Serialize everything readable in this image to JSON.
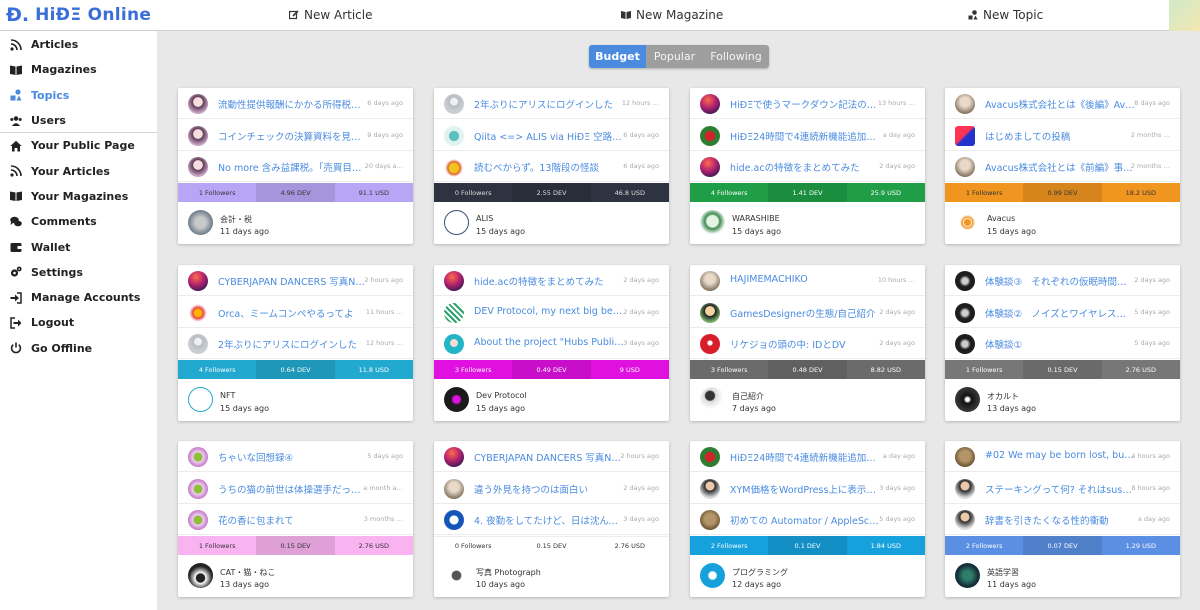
{
  "header": {
    "logo_text": "HiÐΞ Online",
    "logo_mark": "Đ.",
    "nav": [
      {
        "label": "New Article",
        "icon": "edit-icon"
      },
      {
        "label": "New Magazine",
        "icon": "book-icon"
      },
      {
        "label": "New Topic",
        "icon": "shapes-icon"
      }
    ]
  },
  "sidebar": {
    "items": [
      {
        "label": "Articles",
        "icon": "rss-icon",
        "active": false
      },
      {
        "label": "Magazines",
        "icon": "book-icon",
        "active": false
      },
      {
        "label": "Topics",
        "icon": "shapes-icon",
        "active": true
      },
      {
        "label": "Users",
        "icon": "users-icon",
        "active": false
      },
      {
        "label": "Your Public Page",
        "icon": "home-icon",
        "active": false
      },
      {
        "label": "Your Articles",
        "icon": "rss-icon",
        "active": false
      },
      {
        "label": "Your Magazines",
        "icon": "book-icon",
        "active": false
      },
      {
        "label": "Comments",
        "icon": "comments-icon",
        "active": false
      },
      {
        "label": "Wallet",
        "icon": "wallet-icon",
        "active": false
      },
      {
        "label": "Settings",
        "icon": "cogs-icon",
        "active": false
      },
      {
        "label": "Manage Accounts",
        "icon": "sign-in-icon",
        "active": false
      },
      {
        "label": "Logout",
        "icon": "sign-out-icon",
        "active": false
      },
      {
        "label": "Go Offline",
        "icon": "power-icon",
        "active": false
      }
    ]
  },
  "tabs": [
    {
      "label": "Budget",
      "active": true
    },
    {
      "label": "Popular",
      "active": false
    },
    {
      "label": "Following",
      "active": false
    }
  ],
  "cards": [
    {
      "articles": [
        {
          "title": "流動性提供報酬にかかる所得税に…",
          "time": "6 days ago",
          "avatar": "anime-girl-avatar"
        },
        {
          "title": "コインチェックの決算資料を見て…",
          "time": "9 days ago",
          "avatar": "anime-girl-avatar"
        },
        {
          "title": "No more 含み益課税。「売買目的…",
          "time": "20 days a…",
          "avatar": "anime-girl-avatar"
        }
      ],
      "followers": "1 Followers",
      "dev": "4.96 DEV",
      "usd": "91.1 USD",
      "color": "#b9a5f5",
      "text_color": "#333",
      "topic": "会計・税",
      "ago": "11 days ago",
      "topic_avatar": "calculator-avatar"
    },
    {
      "articles": [
        {
          "title": "2年ぶりにアリスにログインした",
          "time": "12 hours …",
          "avatar": "default-user-avatar"
        },
        {
          "title": "Qiita <=> ALIS via HiÐΞ 空路開通",
          "time": "6 days ago",
          "avatar": "robot-avatar"
        },
        {
          "title": "読むべからず。13階段の怪談",
          "time": "6 days ago",
          "avatar": "noodle-avatar"
        }
      ],
      "followers": "0 Followers",
      "dev": "2.55 DEV",
      "usd": "46.8 USD",
      "color": "#2d3341",
      "text_color": "#ddd",
      "topic": "ALIS",
      "ago": "15 days ago",
      "topic_avatar": "alis-logo-avatar"
    },
    {
      "articles": [
        {
          "title": "HiÐΞで使うマークダウン記法の使…",
          "time": "13 hours …",
          "avatar": "gradient-avatar"
        },
        {
          "title": "HiÐΞ24時間で4連続新機能追加へ…",
          "time": "a day ago",
          "avatar": "among-us-avatar"
        },
        {
          "title": "hide.acの特徴をまとめてみた",
          "time": "2 days ago",
          "avatar": "gradient-avatar"
        }
      ],
      "followers": "4 Followers",
      "dev": "1.41 DEV",
      "usd": "25.9 USD",
      "color": "#1f9e47",
      "text_color": "#fff",
      "topic": "WARASHIBE",
      "ago": "15 days ago",
      "topic_avatar": "warashibe-avatar"
    },
    {
      "articles": [
        {
          "title": "Avacus株式会社とは《後編》Avac…",
          "time": "8 days ago",
          "avatar": "photo-avatar"
        },
        {
          "title": "はじめましての投稿",
          "time": "2 months …",
          "avatar": "logo-avatar"
        },
        {
          "title": "Avacus株式会社とは《前編》事業…",
          "time": "2 months …",
          "avatar": "photo-avatar"
        }
      ],
      "followers": "1 Followers",
      "dev": "0.99 DEV",
      "usd": "18.2 USD",
      "color": "#ef9520",
      "text_color": "#333",
      "topic": "Avacus",
      "ago": "15 days ago",
      "topic_avatar": "eye-logo-avatar"
    },
    {
      "articles": [
        {
          "title": "CYBERJAPAN DANCERS 写真NFT…",
          "time": "2 hours ago",
          "avatar": "gradient-avatar"
        },
        {
          "title": "Orca、ミームコンペやるってよ",
          "time": "11 hours …",
          "avatar": "orca-avatar"
        },
        {
          "title": "2年ぶりにアリスにログインした",
          "time": "12 hours …",
          "avatar": "default-user-avatar"
        }
      ],
      "followers": "4 Followers",
      "dev": "0.64 DEV",
      "usd": "11.8 USD",
      "color": "#22a9cf",
      "text_color": "#fff",
      "topic": "NFT",
      "ago": "15 days ago",
      "topic_avatar": "nft-logo-avatar"
    },
    {
      "articles": [
        {
          "title": "hide.acの特徴をまとめてみた",
          "time": "2 days ago",
          "avatar": "gradient-avatar"
        },
        {
          "title": "DEV Protocol, my next big bet af…",
          "time": "2 days ago",
          "avatar": "dev-logo-avatar"
        },
        {
          "title": "About the project \"Hubs Public S…",
          "time": "3 days ago",
          "avatar": "anime-avatar"
        }
      ],
      "followers": "3 Followers",
      "dev": "0.49 DEV",
      "usd": "9 USD",
      "color": "#e010e0",
      "text_color": "#fff",
      "topic": "Dev Protocol",
      "ago": "15 days ago",
      "topic_avatar": "dev-protocol-avatar"
    },
    {
      "articles": [
        {
          "title": "HAJIMEMACHIKO",
          "time": "10 hours …",
          "avatar": "photo-avatar"
        },
        {
          "title": "GamesDesignerの生態/自己紹介",
          "time": "2 days ago",
          "avatar": "cartoon-avatar"
        },
        {
          "title": "リケジョの頭の中: IDとDV",
          "time": "2 days ago",
          "avatar": "elmo-avatar"
        }
      ],
      "followers": "3 Followers",
      "dev": "0.48 DEV",
      "usd": "8.82 USD",
      "color": "#6b6b6b",
      "text_color": "#fff",
      "topic": "自己紹介",
      "ago": "7 days ago",
      "topic_avatar": "person-writing-avatar"
    },
    {
      "articles": [
        {
          "title": "体験談③　それぞれの仮眠時間の話",
          "time": "2 days ago",
          "avatar": "dark-avatar"
        },
        {
          "title": "体験談②　ノイズとワイヤレスの…",
          "time": "5 days ago",
          "avatar": "dark-avatar"
        },
        {
          "title": "体験談①",
          "time": "5 days ago",
          "avatar": "dark-avatar"
        }
      ],
      "followers": "1 Followers",
      "dev": "0.15 DEV",
      "usd": "2.76 USD",
      "color": "#777777",
      "text_color": "#fff",
      "topic": "オカルト",
      "ago": "13 days ago",
      "topic_avatar": "occult-avatar"
    },
    {
      "articles": [
        {
          "title": "ちゃいな回想録④",
          "time": "5 days ago",
          "avatar": "monkey-avatar"
        },
        {
          "title": "うちの猫の前世は体操選手だった…",
          "time": "a month a…",
          "avatar": "monkey-avatar"
        },
        {
          "title": "花の香に包まれて",
          "time": "3 months …",
          "avatar": "monkey-avatar"
        }
      ],
      "followers": "1 Followers",
      "dev": "0.15 DEV",
      "usd": "2.76 USD",
      "color": "#f8b3f0",
      "text_color": "#333",
      "topic": "CAT・猫・ねこ",
      "ago": "13 days ago",
      "topic_avatar": "paw-avatar"
    },
    {
      "articles": [
        {
          "title": "CYBERJAPAN DANCERS 写真NFT…",
          "time": "2 hours ago",
          "avatar": "gradient-avatar"
        },
        {
          "title": "違う外見を持つのは面白い",
          "time": "2 days ago",
          "avatar": "photo-avatar"
        },
        {
          "title": "4. 夜勤をしてたけど、日は沈んで…",
          "time": "3 days ago",
          "avatar": "number-avatar"
        }
      ],
      "followers": "0 Followers",
      "dev": "0.15 DEV",
      "usd": "2.76 USD",
      "color": "#ffffff",
      "text_color": "#333",
      "topic": "写真 Photograph",
      "ago": "10 days ago",
      "topic_avatar": "camera-avatar"
    },
    {
      "articles": [
        {
          "title": "HiÐΞ24時間で4連続新機能追加へ…",
          "time": "a day ago",
          "avatar": "among-us-avatar"
        },
        {
          "title": "XYM価格をWordPress上に表示す…",
          "time": "3 days ago",
          "avatar": "person-avatar"
        },
        {
          "title": "初めての Automator / AppleScrip…",
          "time": "5 days ago",
          "avatar": "statue-avatar"
        }
      ],
      "followers": "2 Followers",
      "dev": "0.1 DEV",
      "usd": "1.84 USD",
      "color": "#16a0dc",
      "text_color": "#fff",
      "topic": "プログラミング",
      "ago": "12 days ago",
      "topic_avatar": "code-avatar"
    },
    {
      "articles": [
        {
          "title": "#02 We may be born lost, but no…",
          "time": "4 hours ago",
          "avatar": "statue-avatar"
        },
        {
          "title": "ステーキングって何? それはsushi…",
          "time": "8 hours ago",
          "avatar": "person-avatar"
        },
        {
          "title": "辞書を引きたくなる性的衝動",
          "time": "a day ago",
          "avatar": "person-avatar"
        }
      ],
      "followers": "2 Followers",
      "dev": "0.07 DEV",
      "usd": "1.29 USD",
      "color": "#5b8fe3",
      "text_color": "#fff",
      "topic": "英語学習",
      "ago": "11 days ago",
      "topic_avatar": "globe-avatar"
    }
  ]
}
